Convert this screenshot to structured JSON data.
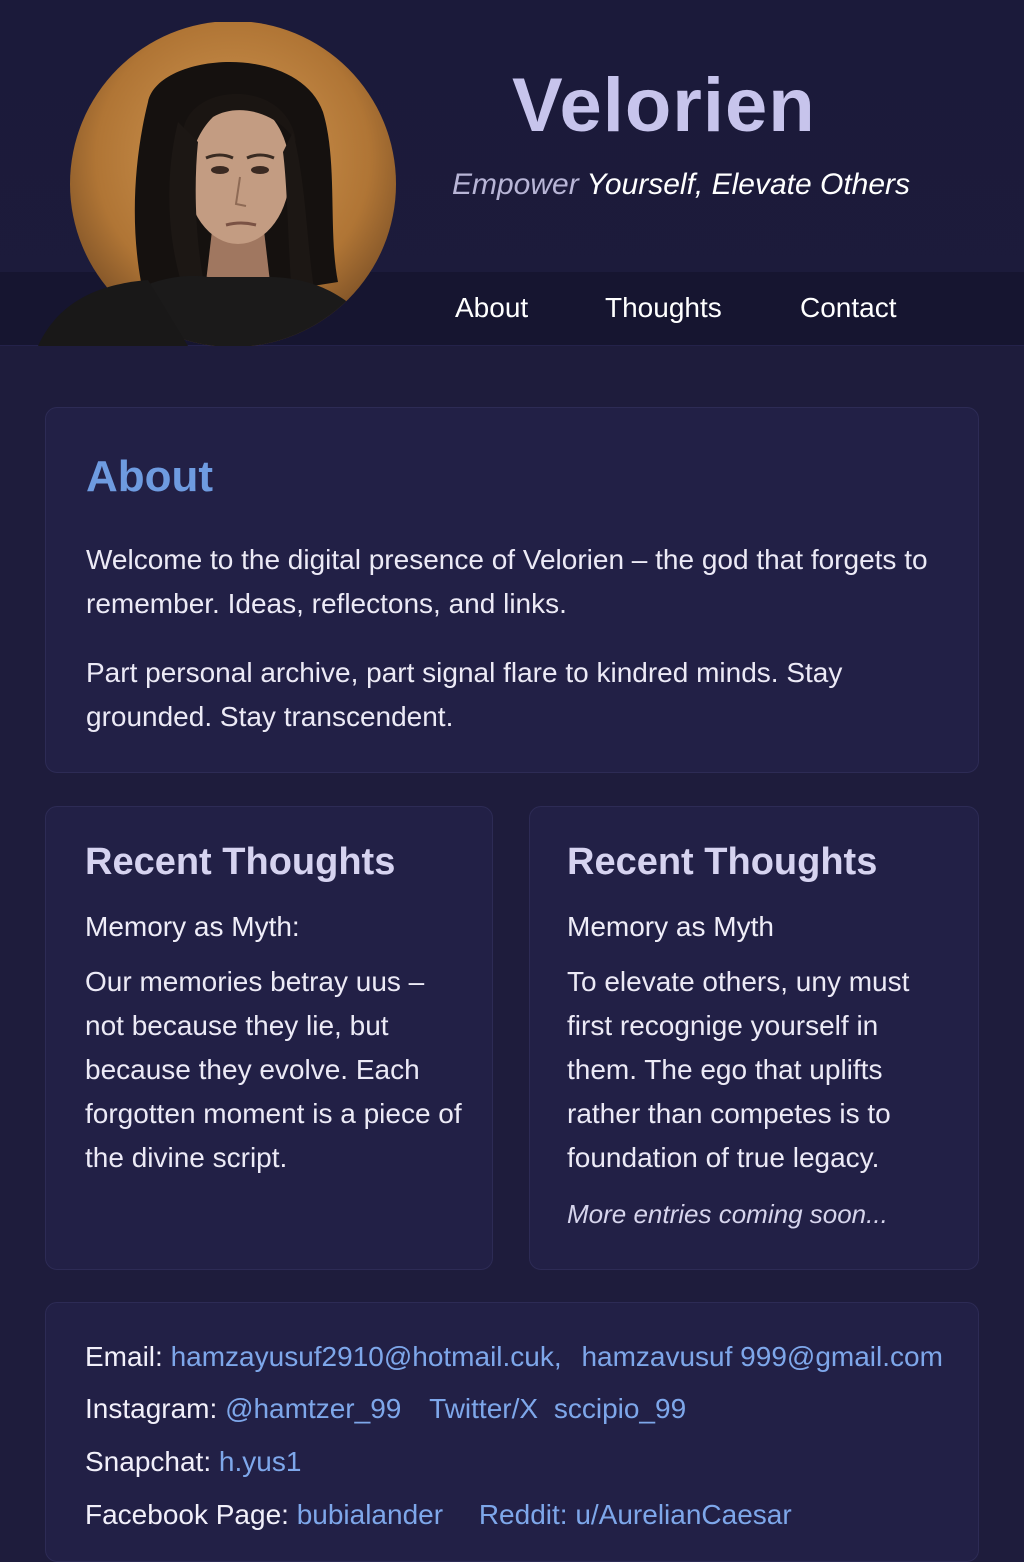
{
  "site": {
    "title": "Velorien",
    "tagline_start": "Empower",
    "tagline_end": "Yourself, Elevate Others"
  },
  "nav": {
    "items": [
      "About",
      "Thoughts",
      "Contact"
    ]
  },
  "about": {
    "heading": "About",
    "paragraph_1": "Welcome to the digital presence of Velorien – the god that forgets to remember. Ideas, reflectons, and links.",
    "paragraph_2": "Part personal archive, part signal flare to kindred minds. Stay grounded. Stay transcendent."
  },
  "thoughts": [
    {
      "heading": "Recent Thoughts",
      "subheading": "Memory as Myth:",
      "body": "Our memories betray uus – not because they lie, but because they evolve. Each forgotten moment is a piece of the divine script."
    },
    {
      "heading": "Recent Thoughts",
      "subheading": "Memory as Myth",
      "body": "To elevate others, uny must first recognige yourself in them. The ego that uplifts rather than competes is to foundation of true legacy.",
      "more": "More entries coming soon..."
    }
  ],
  "contact": {
    "email_label": "Email:",
    "email_1": "hamzayusuf2910@hotmail.cuk,",
    "email_2": "hamzavusuf 999@gmail.com",
    "instagram_label": "Instagram:",
    "instagram": "@hamtzer_99",
    "twitter_label": "Twitter/X",
    "twitter": "sccipio_99",
    "snapchat_label": "Snapchat:",
    "snapchat": "h.yus1",
    "facebook_label": "Facebook Page:",
    "facebook": "bubialander",
    "reddit": "Reddit: u/AurelianCaesar"
  },
  "colors": {
    "background": "#1e1c3c",
    "card": "#222046",
    "accent_heading": "#6e9be0",
    "link": "#7ea7ea",
    "title": "#c7c4ec"
  }
}
